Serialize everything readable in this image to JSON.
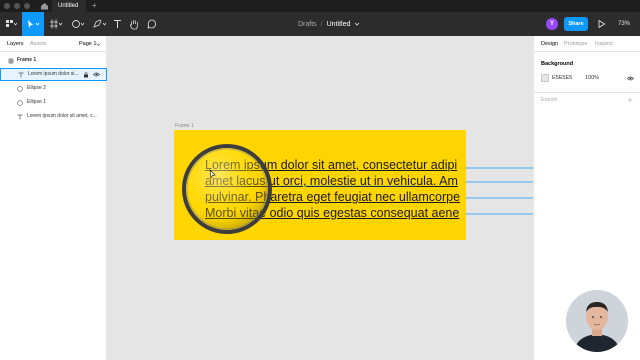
{
  "window": {
    "tab_title": "Untitled",
    "tab_add": "+"
  },
  "toolbar": {
    "breadcrumb_parent": "Drafts",
    "breadcrumb_separator": "/",
    "file_name": "Untitled",
    "avatar_initial": "Y",
    "share_label": "Share",
    "zoom_label": "73%",
    "icons": [
      "figma-menu-icon",
      "move-tool-icon",
      "frame-tool-icon",
      "shape-tool-icon",
      "pen-tool-icon",
      "text-tool-icon",
      "hand-tool-icon",
      "comment-tool-icon",
      "present-icon"
    ]
  },
  "left_panel": {
    "tabs": [
      "Layers",
      "Assets"
    ],
    "page_selector": "Page 1",
    "layers": [
      {
        "name": "Frame 1",
        "icon": "frame-icon"
      },
      {
        "name": "Lorem ipsum dolor si...",
        "icon": "text-icon",
        "selected": true
      },
      {
        "name": "Ellipse 2",
        "icon": "ellipse-icon"
      },
      {
        "name": "Ellipse 1",
        "icon": "ellipse-icon"
      },
      {
        "name": "Lorem ipsum dolor sit amet, c...",
        "icon": "text-icon"
      }
    ]
  },
  "canvas": {
    "frame_label": "Frame 1",
    "frame_color": "#ffd500",
    "text_lines": [
      "Lorem ipsum dolor sit amet, consectetur adipi",
      "amet lacus ut orci, molestie ut in vehicula. Am",
      "pulvinar. Pharetra eget feugiat nec ullamcorpe",
      "Morbi vitae odio quis egestas consequat aene"
    ]
  },
  "right_panel": {
    "tabs": [
      "Design",
      "Prototype",
      "Inspect"
    ],
    "background_heading": "Background",
    "background_hex": "E5E5E5",
    "background_opacity": "100%",
    "export_heading": "Export"
  },
  "colors": {
    "accent": "#0d99ff",
    "toolbar_bg": "#2c2c2c",
    "canvas_bg": "#e5e5e5",
    "avatar": "#9747ff"
  }
}
